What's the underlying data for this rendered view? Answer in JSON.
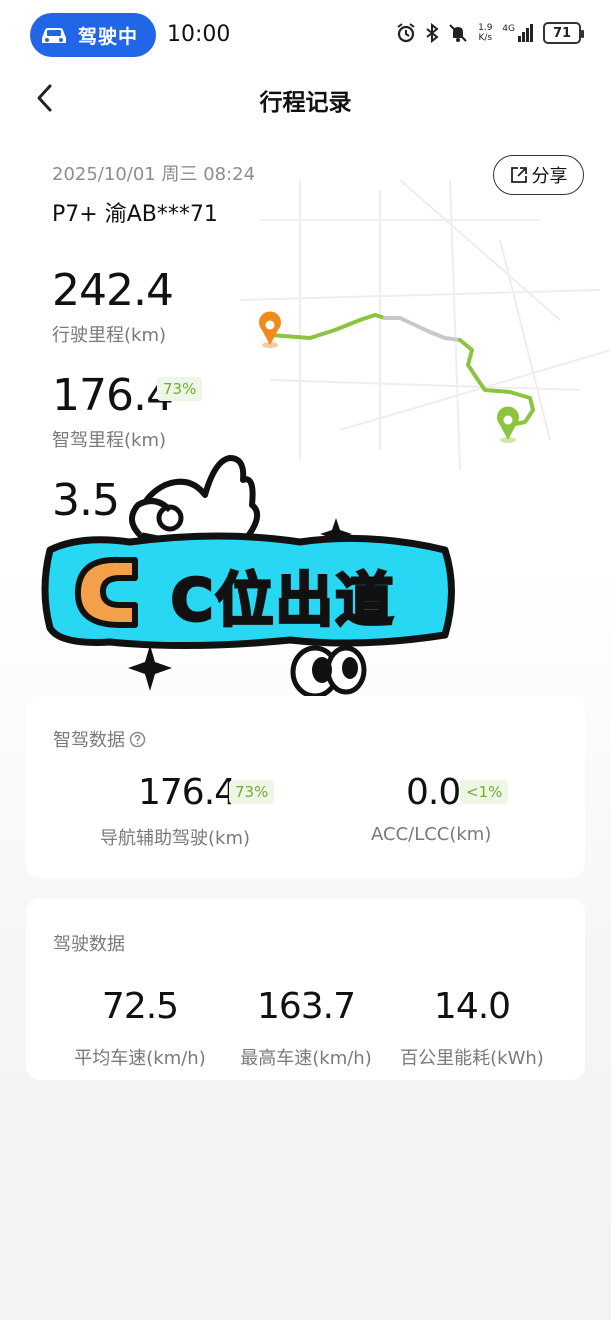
{
  "status_bar": {
    "driving_label": "驾驶中",
    "time": "10:00",
    "net_speed_value": "1.9",
    "net_speed_unit": "K/s",
    "signal_label": "4G",
    "battery": "71"
  },
  "header": {
    "title": "行程记录",
    "share_label": "分享"
  },
  "trip": {
    "datetime": "2025/10/01 周三 08:24",
    "vehicle": "P7+ 渝AB***71",
    "distance_value": "242.4",
    "distance_label": "行驶里程(km)",
    "assist_distance_value": "176.4",
    "assist_distance_pct": "73%",
    "assist_distance_label": "智驾里程(km)",
    "third_value": "3.5"
  },
  "sticker": {
    "text": "C位出道"
  },
  "assist_card": {
    "title": "智驾数据",
    "items": [
      {
        "value": "176.4",
        "badge": "73%",
        "label": "导航辅助驾驶(km)"
      },
      {
        "value": "0.0",
        "badge": "<1%",
        "label": "ACC/LCC(km)"
      }
    ]
  },
  "driving_card": {
    "title": "驾驶数据",
    "items": [
      {
        "value": "72.5",
        "label": "平均车速(km/h)"
      },
      {
        "value": "163.7",
        "label": "最高车速(km/h)"
      },
      {
        "value": "14.0",
        "label": "百公里能耗(kWh)"
      }
    ]
  },
  "colors": {
    "accent_blue": "#2266e8",
    "route_green": "#8cc43f",
    "start_orange": "#f08a1c",
    "badge_green": "#6fae36",
    "sticker_cyan": "#28d8f2"
  }
}
